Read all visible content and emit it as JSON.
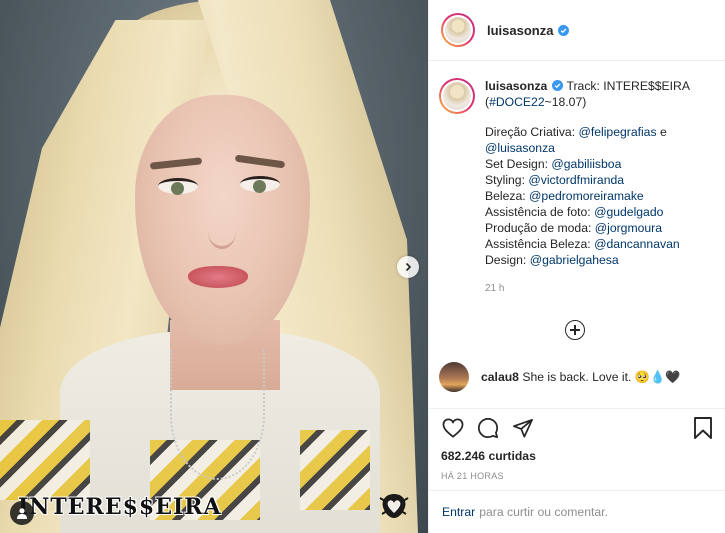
{
  "post": {
    "author": "luisasonza",
    "verified": true,
    "image_watermark": "INTERE$$EIRA"
  },
  "caption": {
    "username": "luisasonza",
    "text_pre": "Track: INTERE$$EIRA (",
    "hashtag": "#DOCE22",
    "text_post": "~18.07)",
    "credits": [
      {
        "label": "Direção Criativa: ",
        "handles": [
          "@felipegrafias",
          "@luisasonza"
        ],
        "joiner": " e "
      },
      {
        "label": "Set Design: ",
        "handles": [
          "@gabiliisboa"
        ]
      },
      {
        "label": "Styling: ",
        "handles": [
          "@victordfmiranda"
        ]
      },
      {
        "label": "Beleza: ",
        "handles": [
          "@pedromoreiramake"
        ]
      },
      {
        "label": "Assistência de foto: ",
        "handles": [
          "@gudelgado"
        ]
      },
      {
        "label": "Produção de moda: ",
        "handles": [
          "@jorgmoura"
        ]
      },
      {
        "label": "Assistência Beleza: ",
        "handles": [
          "@dancannavan"
        ]
      },
      {
        "label": "Design: ",
        "handles": [
          "@gabrielgahesa"
        ]
      }
    ],
    "time": "21 h"
  },
  "comments": [
    {
      "username": "calau8",
      "text": "She is back. Love it. 🥺💧🖤"
    }
  ],
  "stats": {
    "likes": "682.246 curtidas",
    "posted": "HÁ 21 HORAS"
  },
  "footer": {
    "login": "Entrar",
    "rest": "para curtir ou comentar."
  },
  "icons": {
    "like": "heart-icon",
    "comment": "comment-icon",
    "share": "paper-plane-icon",
    "save": "bookmark-icon",
    "more": "more-options-icon",
    "next": "chevron-right-icon",
    "tag": "user-tag-icon",
    "load_more": "plus-circle-icon"
  },
  "colors": {
    "link": "#00376b",
    "verified": "#3897f0",
    "muted": "#8e8e8e"
  }
}
